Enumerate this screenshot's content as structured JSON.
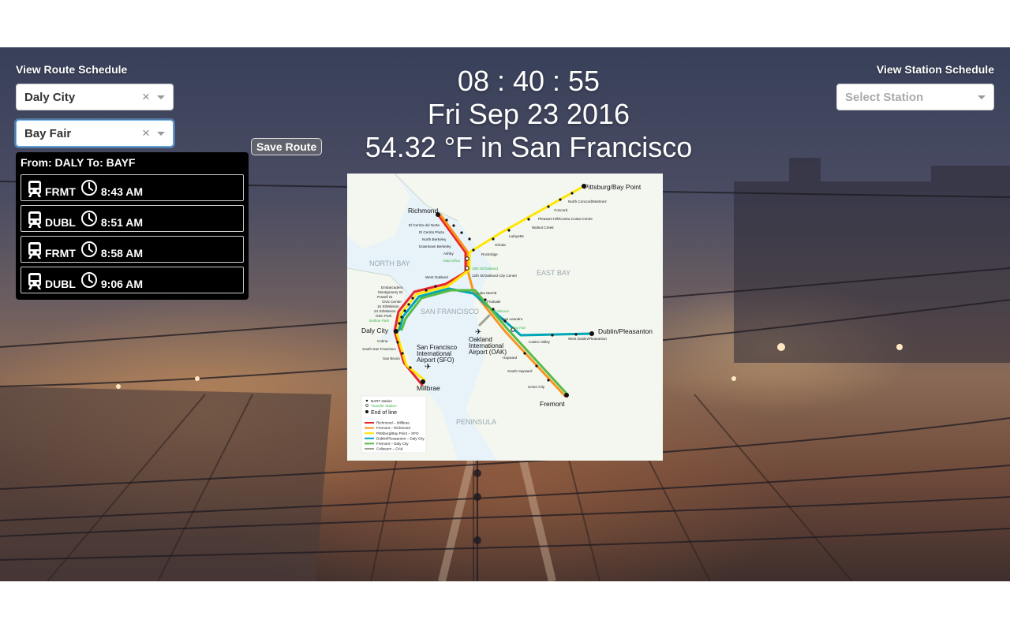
{
  "route_schedule": {
    "title": "View Route Schedule",
    "origin": "Daly City",
    "destination": "Bay Fair",
    "save_label": "Save Route",
    "results_header": "From: DALY To: BAYF",
    "trains": [
      {
        "route": "FRMT",
        "time": "8:43 AM"
      },
      {
        "route": "DUBL",
        "time": "8:51 AM"
      },
      {
        "route": "FRMT",
        "time": "8:58 AM"
      },
      {
        "route": "DUBL",
        "time": "9:06 AM"
      }
    ]
  },
  "station_schedule": {
    "title": "View Station Schedule",
    "placeholder": "Select Station"
  },
  "clock": {
    "time": "08 : 40 : 55",
    "date": "Fri Sep 23 2016",
    "weather": "54.32 °F in San Francisco"
  },
  "map": {
    "regions": [
      "NORTH BAY",
      "EAST BAY",
      "SAN FRANCISCO",
      "PENINSULA"
    ],
    "end_stations": {
      "pittsburg": "Pittsburg/Bay Point",
      "richmond": "Richmond",
      "dublin": "Dublin/Pleasanton",
      "fremont": "Fremont",
      "millbrae": "Millbrae",
      "daly_city": "Daly City"
    },
    "airports": {
      "sfo": [
        "San Francisco",
        "International",
        "Airport (SFO)"
      ],
      "oak": [
        "Oakland",
        "International",
        "Airport (OAK)"
      ]
    },
    "stations": {
      "north_concord": "North Concord/Martinez",
      "concord": "Concord",
      "pleasant_hill": "Pleasant Hill/Contra Costa Centre",
      "walnut_creek": "Walnut Creek",
      "lafayette": "Lafayette",
      "orinda": "Orinda",
      "rockridge": "Rockridge",
      "el_cerrito_del_norte": "El Cerrito del Norte",
      "el_cerrito_plaza": "El Cerrito Plaza",
      "north_berkeley": "North Berkeley",
      "downtown_berkeley": "Downtown Berkeley",
      "ashby": "Ashby",
      "macarthur": "MacArthur",
      "nineteenth_st": "19th St/Oakland",
      "twelfth_st": "12th St/Oakland City Center",
      "west_oakland": "West Oakland",
      "embarcadero": "Embarcadero",
      "montgomery": "Montgomery St",
      "powell": "Powell St",
      "civic_center": "Civic Center",
      "sixteenth_st": "16 St/Mission",
      "twentyfourth_st": "24 St/Mission",
      "glen_park": "Glen Park",
      "balboa_park": "Balboa Park",
      "colma": "Colma",
      "south_sf": "South San Francisco",
      "san_bruno": "San Bruno",
      "lake_merritt": "Lake Merritt",
      "fruitvale": "Fruitvale",
      "coliseum": "Coliseum",
      "san_leandro": "San Leandro",
      "bay_fair": "Bay Fair",
      "castro_valley": "Castro Valley",
      "west_dublin": "West Dublin/Pleasanton",
      "hayward": "Hayward",
      "south_hayward": "South Hayward",
      "union_city": "Union City"
    },
    "legend": {
      "bart_station": "BART station",
      "transfer_station": "Transfer Station",
      "end_of_line": "End of line",
      "lines": [
        {
          "name": "Richmond – Millbrae",
          "color": "#e8262a"
        },
        {
          "name": "Fremont – Richmond",
          "color": "#f7941d"
        },
        {
          "name": "Pittsburg/Bay Point – SFO",
          "color": "#ffe600"
        },
        {
          "name": "Dublin/Pleasanton – Daly City",
          "color": "#00a6b6"
        },
        {
          "name": "Fremont – Daly City",
          "color": "#59bb47"
        },
        {
          "name": "Coliseum – OAK",
          "color": "#a1a193"
        }
      ]
    }
  },
  "colors": {
    "focus_border": "#66afe9",
    "panel_bg": "#000000"
  }
}
